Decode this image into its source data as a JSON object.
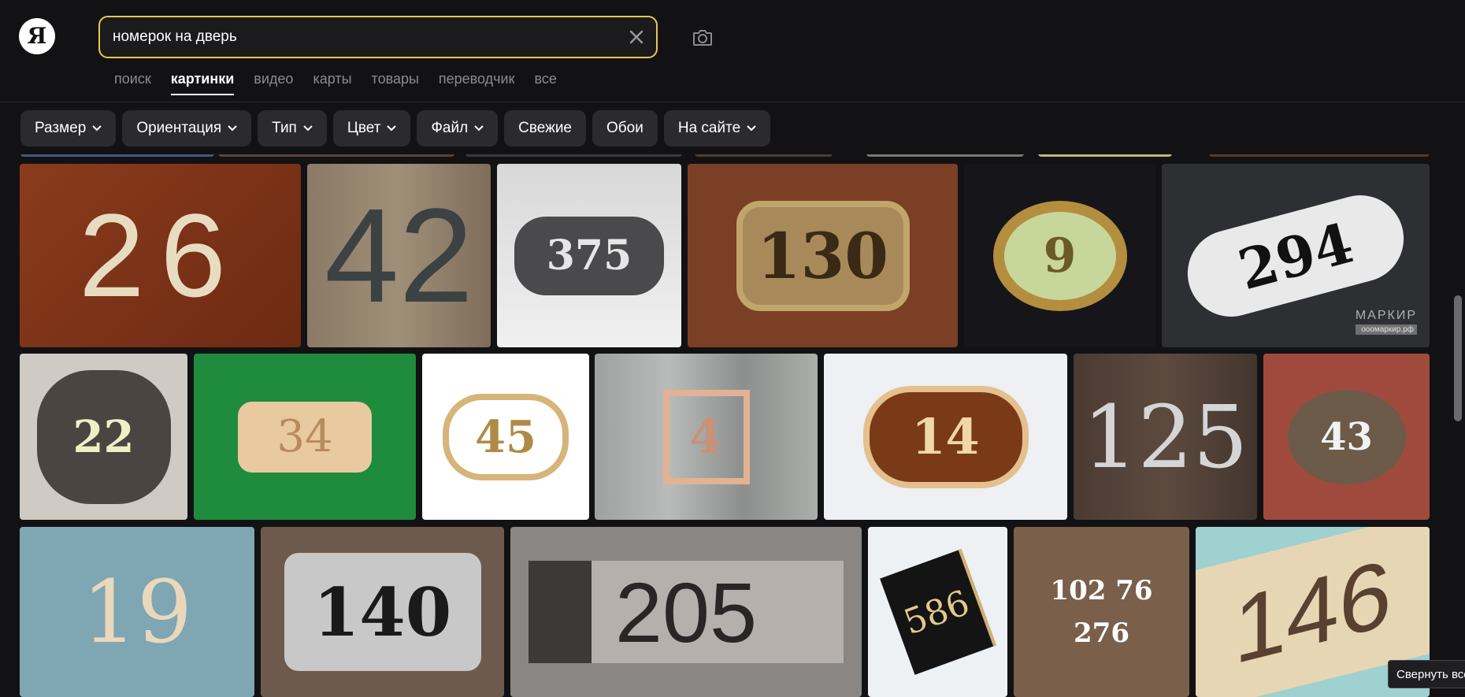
{
  "logo": {
    "letter": "Я"
  },
  "search": {
    "value": "номерок на дверь",
    "placeholder": ""
  },
  "tabs": [
    {
      "label": "поиск",
      "active": false
    },
    {
      "label": "картинки",
      "active": true
    },
    {
      "label": "видео",
      "active": false
    },
    {
      "label": "карты",
      "active": false
    },
    {
      "label": "товары",
      "active": false
    },
    {
      "label": "переводчик",
      "active": false
    },
    {
      "label": "все",
      "active": false
    }
  ],
  "filters": [
    {
      "label": "Размер",
      "dropdown": true
    },
    {
      "label": "Ориентация",
      "dropdown": true
    },
    {
      "label": "Тип",
      "dropdown": true
    },
    {
      "label": "Цвет",
      "dropdown": true
    },
    {
      "label": "Файл",
      "dropdown": true
    },
    {
      "label": "Свежие",
      "dropdown": false
    },
    {
      "label": "Обои",
      "dropdown": false
    },
    {
      "label": "На сайте",
      "dropdown": true
    }
  ],
  "images": {
    "row1": [
      "26",
      "42",
      "375",
      "130",
      "9",
      "294"
    ],
    "row2": [
      "22",
      "34",
      "45",
      "4",
      "14",
      "125",
      "43"
    ],
    "row3": [
      "19",
      "140",
      "205",
      "586",
      "102 76 276",
      "146"
    ],
    "watermark": {
      "brand": "МАРКИР",
      "site": "ооомаркир.рф"
    }
  },
  "tooltip": {
    "collapse": "Свернуть все"
  },
  "colors": {
    "accent": "#e8c84d",
    "background": "#121214",
    "chip": "#2b2b2f"
  }
}
